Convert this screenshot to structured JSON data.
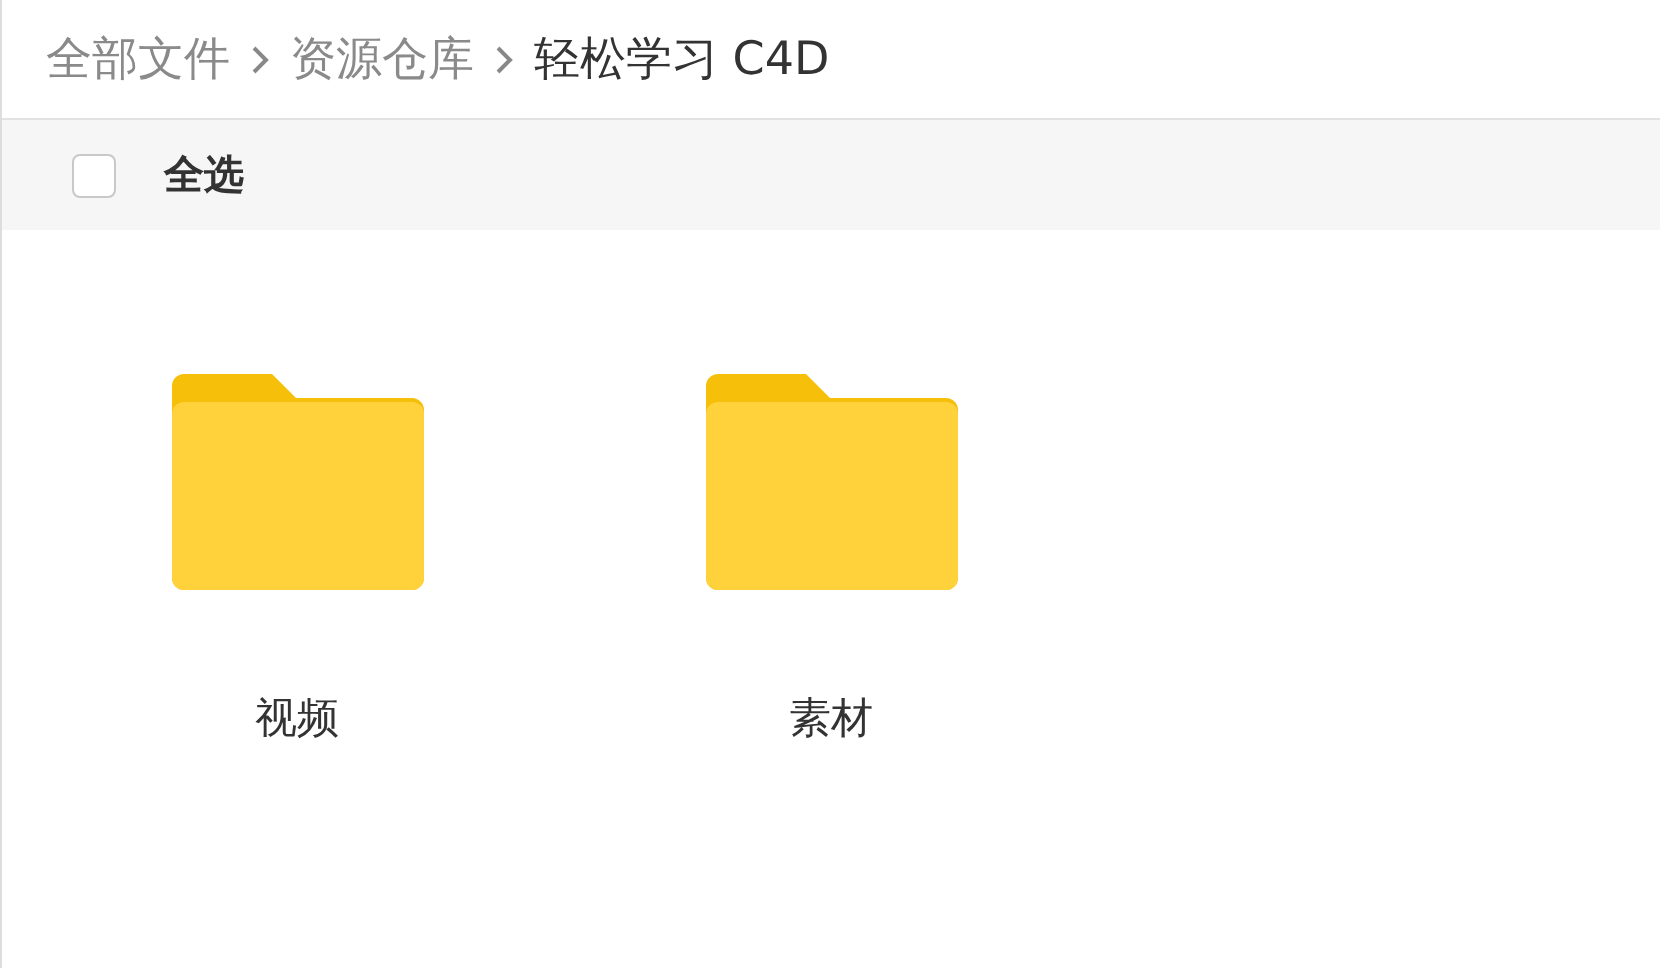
{
  "breadcrumb": [
    {
      "label": "全部文件",
      "current": false
    },
    {
      "label": "资源仓库",
      "current": false
    },
    {
      "label": "轻松学习 C4D",
      "current": true
    }
  ],
  "select_all": {
    "label": "全选",
    "checked": false
  },
  "files": [
    {
      "kind": "folder",
      "name": "视频"
    },
    {
      "kind": "folder",
      "name": "素材"
    }
  ]
}
